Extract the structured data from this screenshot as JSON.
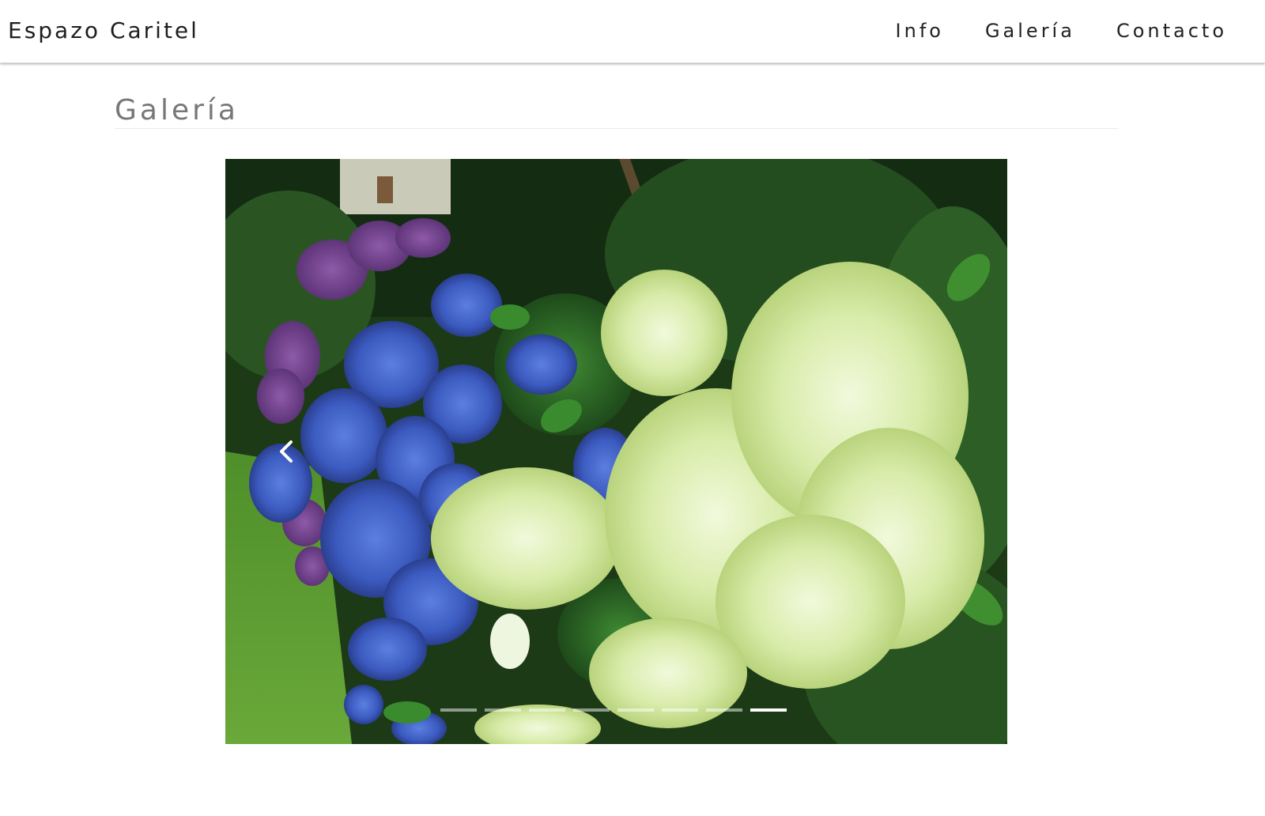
{
  "brand": {
    "name": "Espazo Caritel"
  },
  "nav": {
    "items": [
      {
        "label": "Info"
      },
      {
        "label": "Galería"
      },
      {
        "label": "Contacto"
      }
    ]
  },
  "gallery": {
    "title": "Galería",
    "slide_count": 8,
    "active_slide": 8,
    "image_subject": "hydrangea-garden-photo"
  },
  "colors": {
    "text_dark": "#1e1e1e",
    "title_gray": "#777777",
    "indicator_inactive": "rgba(255,255,255,0.5)",
    "indicator_active": "#ffffff"
  }
}
